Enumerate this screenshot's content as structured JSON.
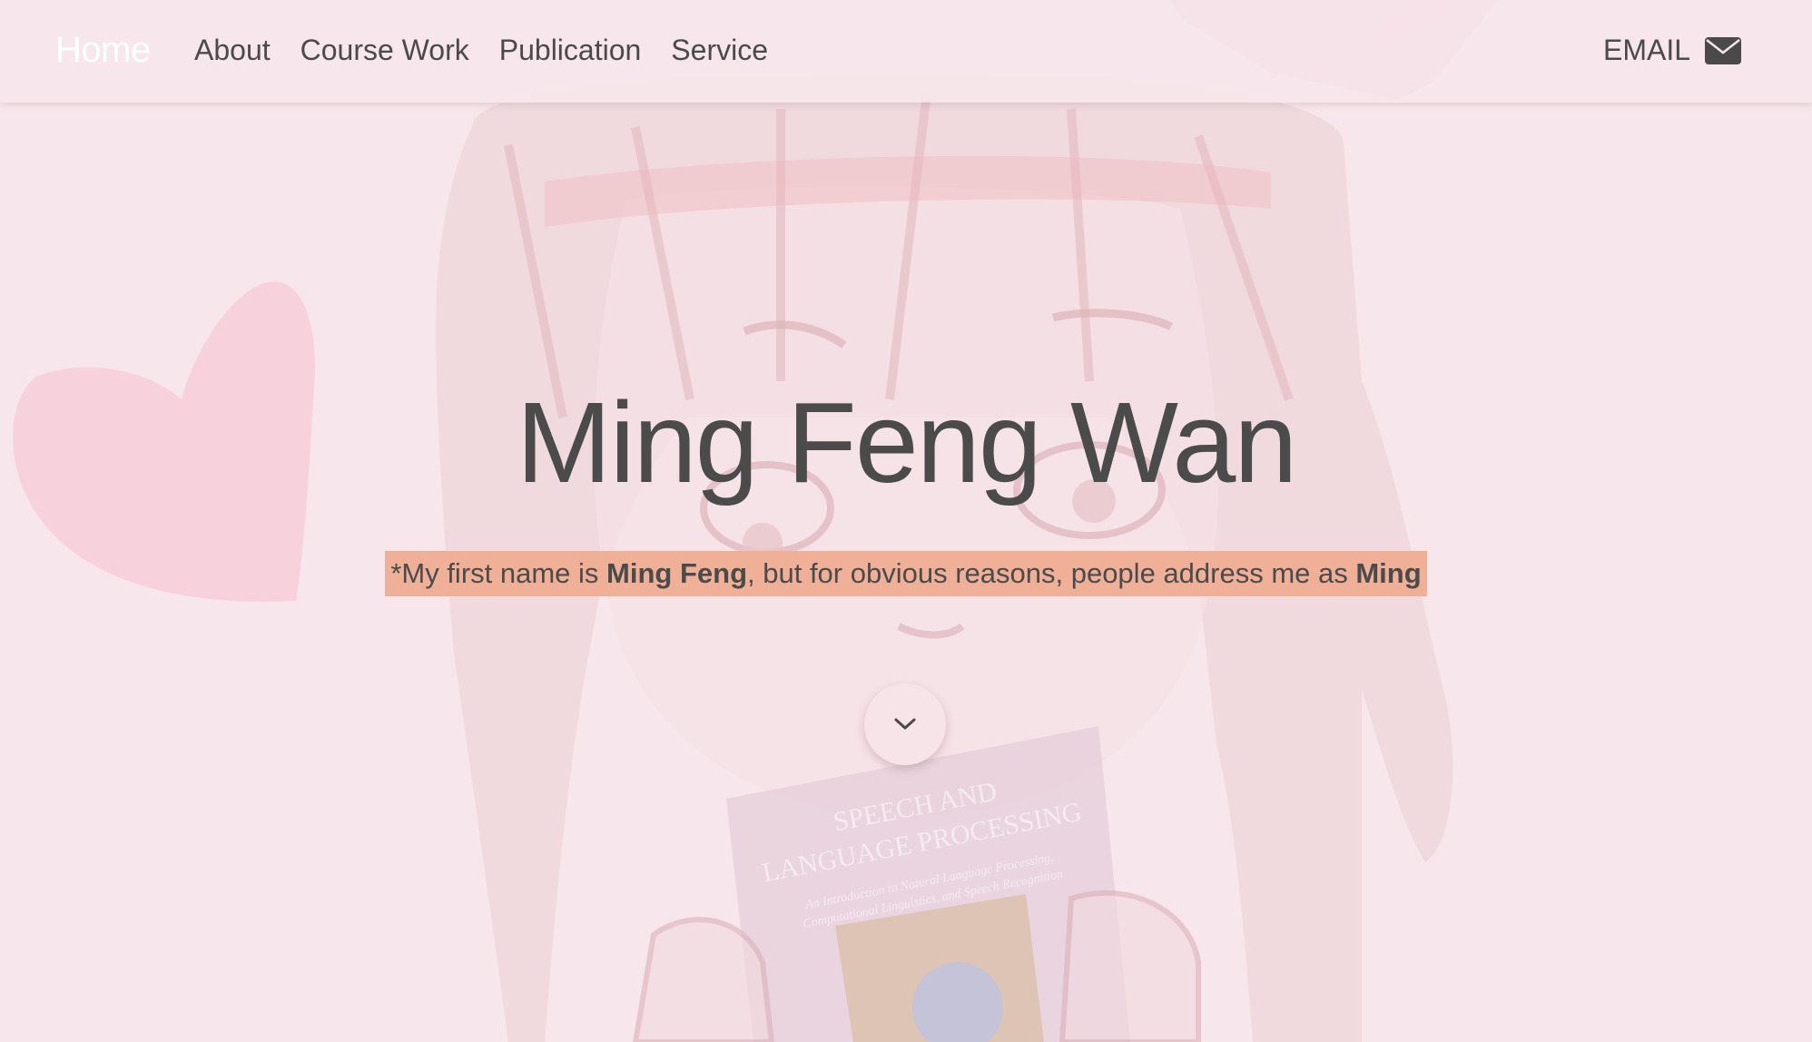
{
  "navbar": {
    "brand": "Home",
    "links": [
      "About",
      "Course Work",
      "Publication",
      "Service"
    ],
    "email_label": "EMAIL",
    "email_icon": "envelope-icon"
  },
  "hero": {
    "title": "Ming Feng Wan",
    "subtitle": {
      "prefix": "*My first name is ",
      "bold_name": "Ming Feng",
      "middle": ", but for obvious reasons, people address me as ",
      "bold_short": "Ming"
    },
    "scroll_icon": "chevron-down-icon"
  },
  "background": {
    "book_title_line1": "SPEECH AND",
    "book_title_line2": "LANGUAGE PROCESSING",
    "book_subtitle_line1": "An Introduction to Natural Language Processing,",
    "book_subtitle_line2": "Computational Linguistics, and Speech Recognition"
  },
  "colors": {
    "page_background": "#f7e6eb",
    "text": "#4b4b4b",
    "highlight": "#f0b098",
    "heart": "#f6c8d6"
  }
}
